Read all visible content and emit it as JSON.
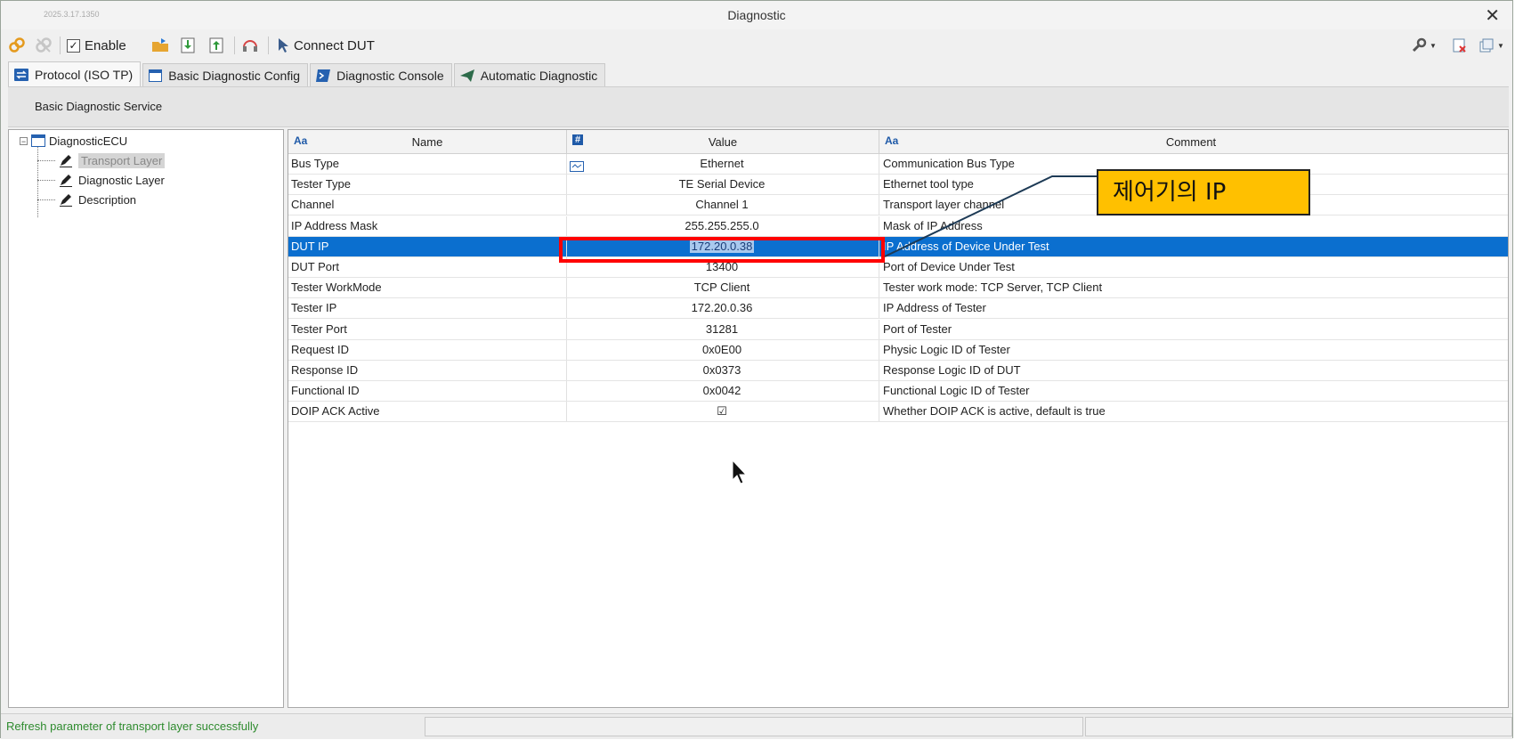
{
  "window": {
    "title": "Diagnostic",
    "version": "2025.3.17.1350",
    "close_glyph": "✕"
  },
  "toolbar": {
    "enable_label": "Enable",
    "enable_checked": true,
    "connect_label": "Connect DUT"
  },
  "tabs": [
    {
      "label": "Protocol (ISO TP)",
      "active": true
    },
    {
      "label": "Basic Diagnostic Config",
      "active": false
    },
    {
      "label": "Diagnostic Console",
      "active": false
    },
    {
      "label": "Automatic Diagnostic",
      "active": false
    }
  ],
  "panel": {
    "header": "Basic Diagnostic Service"
  },
  "tree": {
    "root": "DiagnosticECU",
    "expander": "−",
    "children": [
      "Transport Layer",
      "Diagnostic Layer",
      "Description"
    ],
    "selected_child": "Transport Layer"
  },
  "grid": {
    "columns": {
      "name": "Name",
      "value": "Value",
      "comment": "Comment"
    },
    "type_icons": {
      "name": "Aa",
      "value": "#",
      "comment": "Aa"
    },
    "rows": [
      {
        "name": "Bus Type",
        "value": "Ethernet",
        "comment": "Communication Bus Type"
      },
      {
        "name": "Tester Type",
        "value": "TE Serial Device",
        "comment": "Ethernet tool type"
      },
      {
        "name": "Channel",
        "value": "Channel 1",
        "comment": "Transport layer channel"
      },
      {
        "name": "IP Address Mask",
        "value": "255.255.255.0",
        "comment": "Mask of IP Address"
      },
      {
        "name": "DUT IP",
        "value": "172.20.0.38",
        "comment": "IP Address of Device Under Test"
      },
      {
        "name": "DUT Port",
        "value": "13400",
        "comment": "Port of Device Under Test"
      },
      {
        "name": "Tester WorkMode",
        "value": "TCP Client",
        "comment": "Tester work mode: TCP Server, TCP Client"
      },
      {
        "name": "Tester IP",
        "value": "172.20.0.36",
        "comment": "IP Address of Tester"
      },
      {
        "name": "Tester Port",
        "value": "31281",
        "comment": "Port of Tester"
      },
      {
        "name": "Request ID",
        "value": "0x0E00",
        "comment": "Physic Logic ID of Tester"
      },
      {
        "name": "Response ID",
        "value": "0x0373",
        "comment": "Response Logic ID of DUT"
      },
      {
        "name": "Functional ID",
        "value": "0x0042",
        "comment": "Functional Logic ID of Tester"
      },
      {
        "name": "DOIP ACK Active",
        "value": "☑",
        "comment": "Whether DOIP ACK is active, default is true"
      }
    ],
    "selected_row": "DUT IP"
  },
  "status": {
    "message": "Refresh parameter of transport layer successfully"
  },
  "annotation": {
    "callout_text": "제어기의 IP",
    "highlight_color": "#ff0000",
    "callout_color": "#ffc000"
  },
  "colors": {
    "selection": "#0b6fcf",
    "status_text": "#2e8b2e"
  }
}
